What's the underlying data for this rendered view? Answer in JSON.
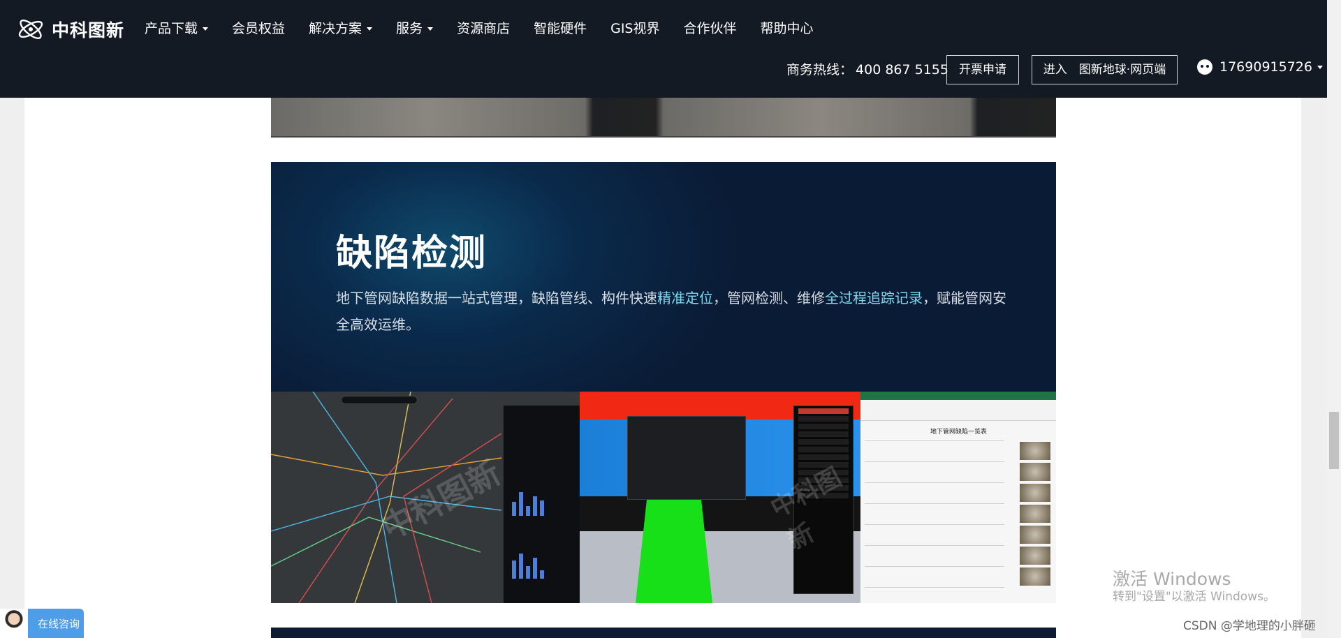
{
  "header": {
    "logo_text": "中科图新",
    "nav": [
      {
        "label": "产品下载",
        "dropdown": true
      },
      {
        "label": "会员权益",
        "dropdown": false
      },
      {
        "label": "解决方案",
        "dropdown": true
      },
      {
        "label": "服务",
        "dropdown": true
      },
      {
        "label": "资源商店",
        "dropdown": false
      },
      {
        "label": "智能硬件",
        "dropdown": false
      },
      {
        "label": "GIS视界",
        "dropdown": false
      },
      {
        "label": "合作伙伴",
        "dropdown": false
      },
      {
        "label": "帮助中心",
        "dropdown": false
      }
    ],
    "hotline_label": "商务热线：",
    "hotline_number": "400 867 5155",
    "invoice_button": "开票申请",
    "enter_button": "进入　图新地球·网页端",
    "user_phone": "17690915726",
    "colors": {
      "header_bg": "#131a24",
      "accent": "#7ed9ee"
    }
  },
  "feature": {
    "title": "缺陷检测",
    "desc_part1": "地下管网缺陷数据一站式管理，缺陷管线、构件快速",
    "desc_hl1": "精准定位",
    "desc_part2": "，管网检测、维修",
    "desc_hl2": "全过程追踪记录",
    "desc_part3": "，赋能管网安全高效运维。",
    "watermark_text": "中科图新",
    "excel_sheet_title": "地下管网缺陷一览表"
  },
  "overlay": {
    "windows_line1": "激活 Windows",
    "windows_line2": "转到\"设置\"以激活 Windows。",
    "csdn_credit": "CSDN @学地理的小胖砸",
    "consult_label": "在线咨询"
  }
}
